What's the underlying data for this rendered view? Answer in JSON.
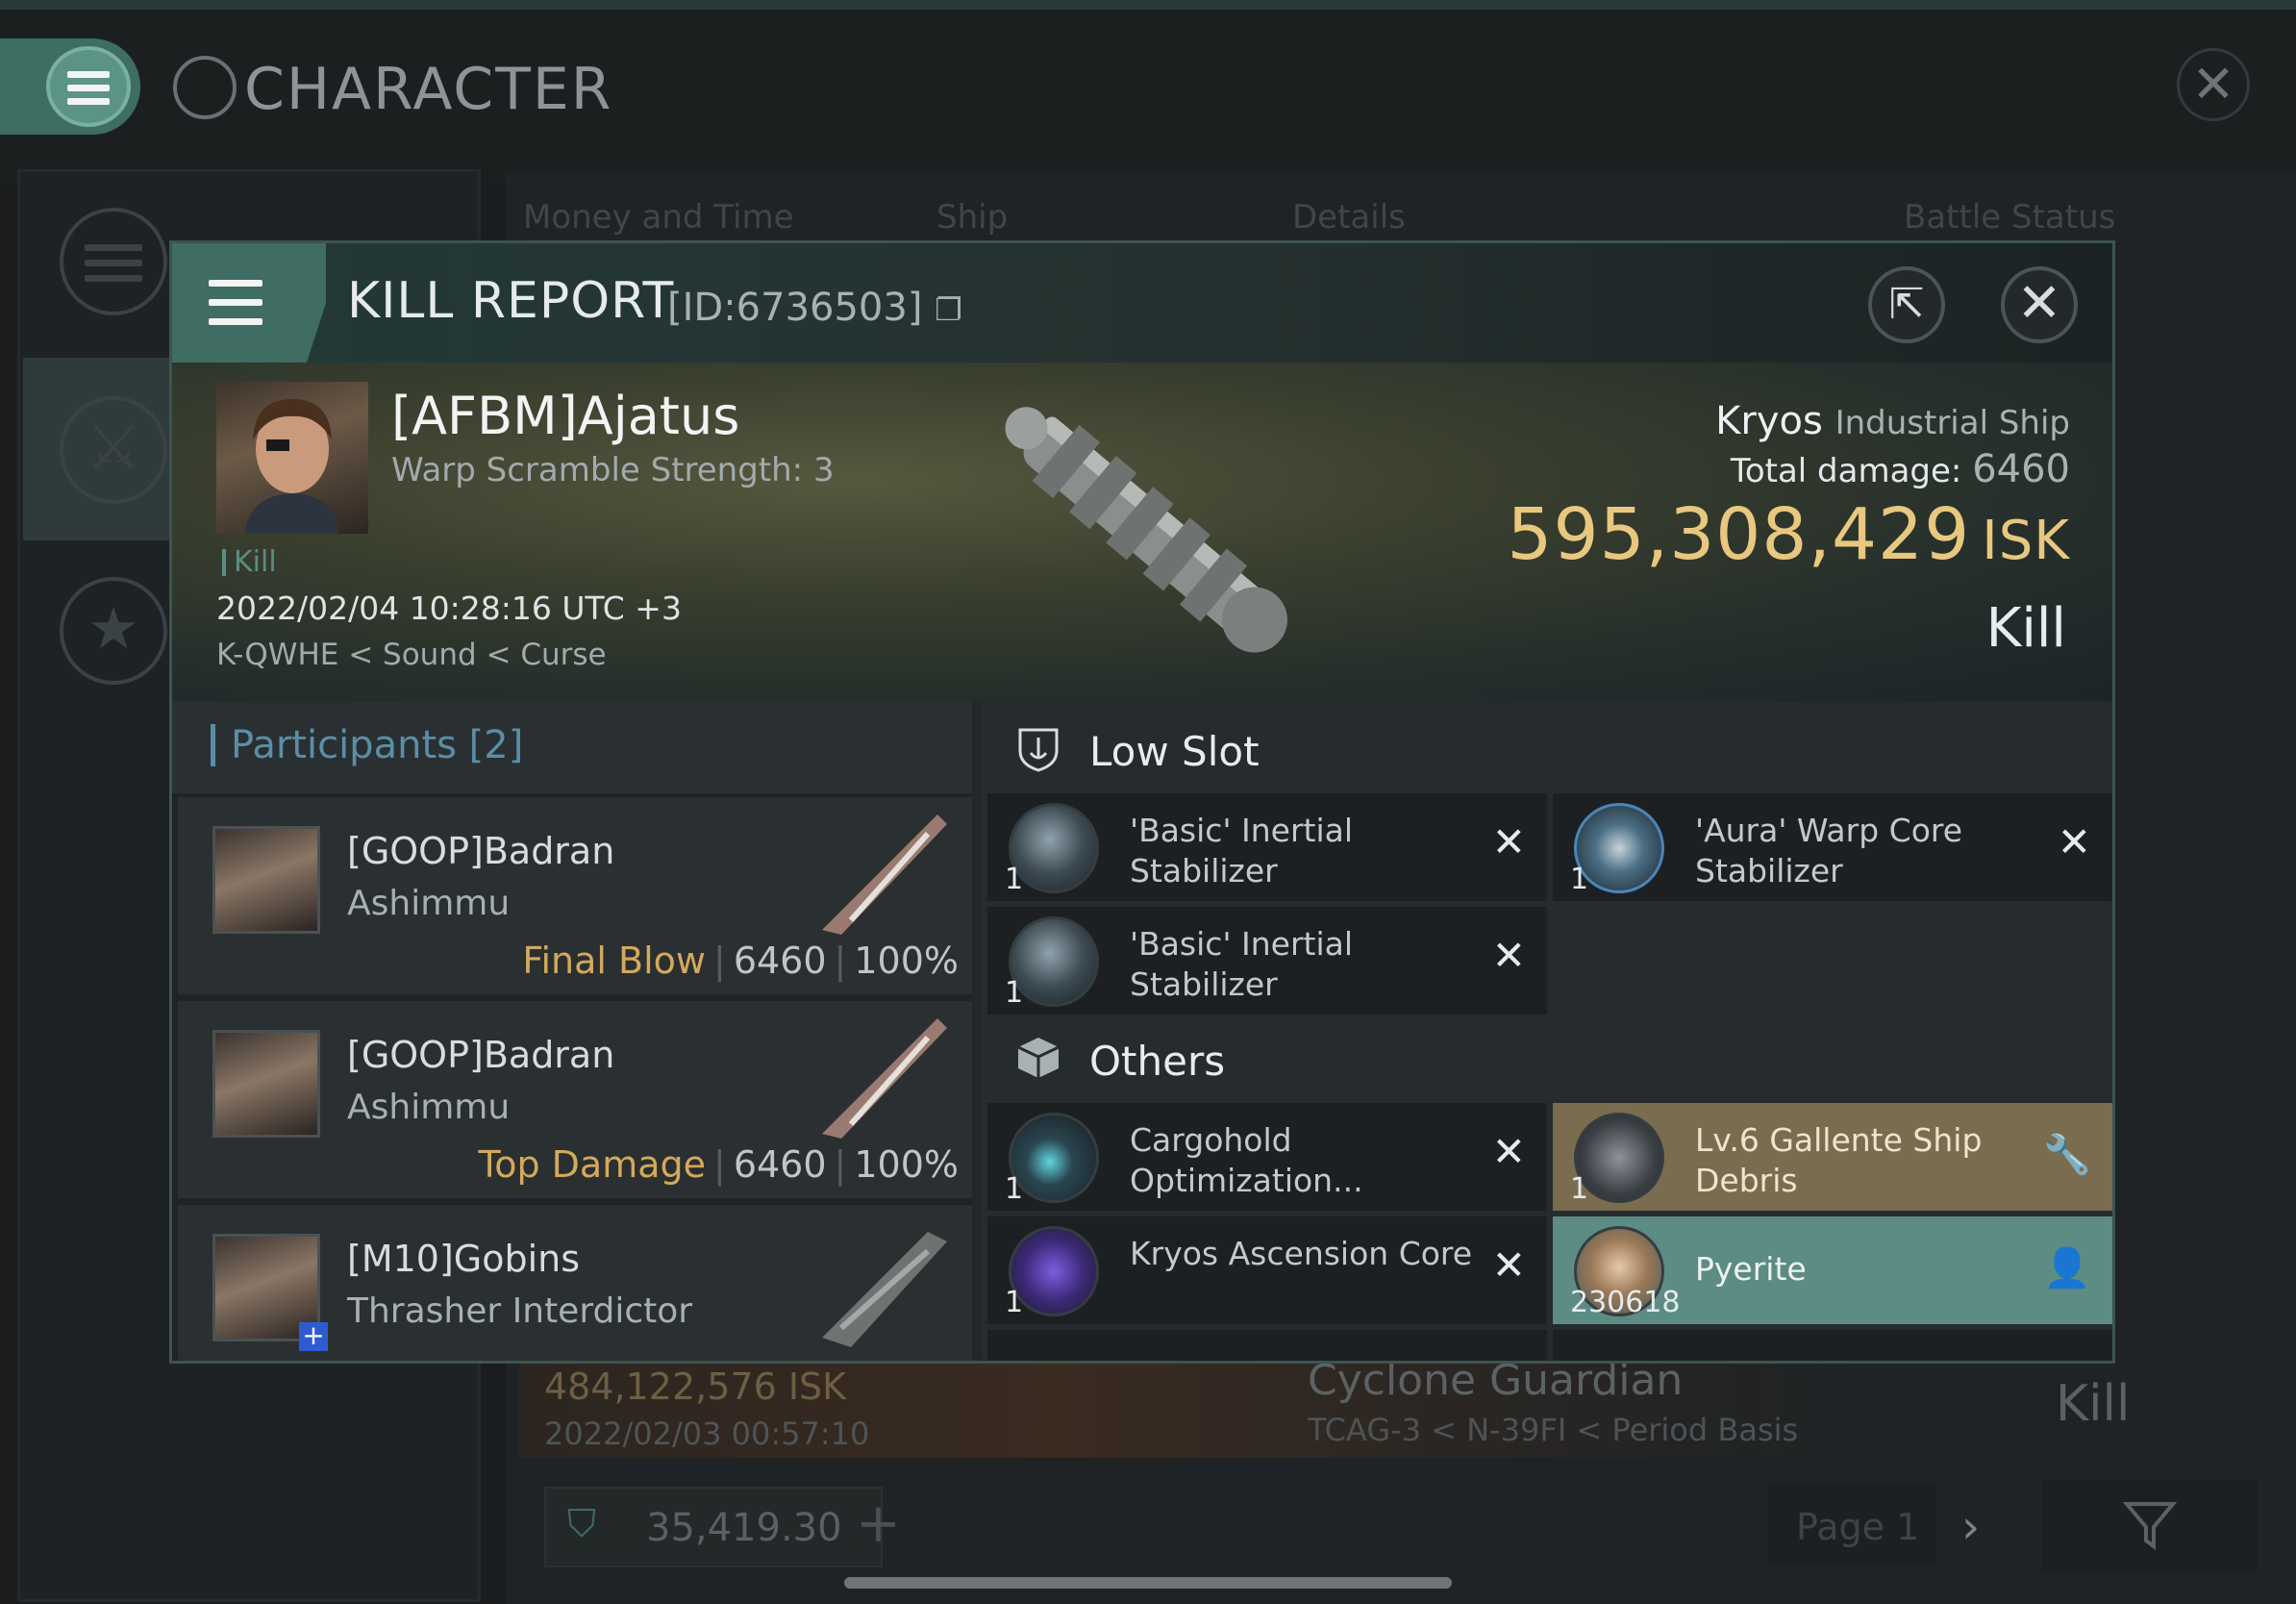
{
  "app": {
    "title": "CHARACTER"
  },
  "background_table": {
    "columns": [
      "Money and Time",
      "Ship",
      "Details",
      "Battle Status"
    ],
    "row": {
      "isk": "484,122,576  ISK",
      "time": "2022/02/03  00:57:10",
      "ship": "Cyclone Guardian",
      "location": "TCAG-3 < N-39FI < Period Basis",
      "result": "Kill"
    },
    "footer": {
      "balance": "35,419.30",
      "page": "Page 1"
    }
  },
  "modal": {
    "title": "KILL REPORT",
    "id_label": "[ID:6736503]",
    "hero": {
      "pilot": "[AFBM]Ajatus",
      "pilot_sub": "Warp Scramble Strength: 3",
      "kill_tag": "Kill",
      "timestamp": "2022/02/04 10:28:16 UTC +3",
      "location": "K-QWHE < Sound < Curse",
      "ship_name": "Kryos",
      "ship_class": "Industrial Ship",
      "total_damage_label": "Total damage:",
      "total_damage": "6460",
      "isk_value": "595,308,429",
      "isk_unit": "ISK",
      "result": "Kill"
    },
    "participants": {
      "heading": "Participants [2]",
      "rows": [
        {
          "name": "[GOOP]Badran",
          "ship": "Ashimmu",
          "label": "Final Blow",
          "damage": "6460",
          "percent": "100%"
        },
        {
          "name": "[GOOP]Badran",
          "ship": "Ashimmu",
          "label": "Top Damage",
          "damage": "6460",
          "percent": "100%"
        },
        {
          "name": "[M10]Gobins",
          "ship": "Thrasher Interdictor",
          "label": "",
          "damage": "",
          "percent": ""
        }
      ]
    },
    "sections": {
      "low_slot": "Low Slot",
      "others": "Others"
    },
    "low_slot_items": [
      {
        "qty": "1",
        "name": "'Basic' Inertial Stabilizer"
      },
      {
        "qty": "1",
        "name": "'Aura' Warp Core Stabilizer"
      },
      {
        "qty": "1",
        "name": "'Basic' Inertial Stabilizer"
      }
    ],
    "other_items": [
      {
        "qty": "1",
        "name": "Cargohold Optimization..."
      },
      {
        "qty": "1",
        "name": "Lv.6 Gallente Ship Debris"
      },
      {
        "qty": "1",
        "name": "Kryos Ascension Core"
      },
      {
        "qty": "230618",
        "name": "Pyerite"
      }
    ]
  },
  "colors": {
    "accent": "#3f6c63",
    "isk_gold": "#e8c77f",
    "final_blow": "#d4a95b",
    "loot_bg": "#7a6c4f",
    "teal_row": "#5c8c84"
  },
  "icons": [
    "menu-icon",
    "character-icon",
    "close-icon",
    "share-icon",
    "copy-icon",
    "shield-icon",
    "cube-icon",
    "wrench-icon",
    "person-icon",
    "filter-icon",
    "star-icon",
    "crossed-swords-icon"
  ]
}
